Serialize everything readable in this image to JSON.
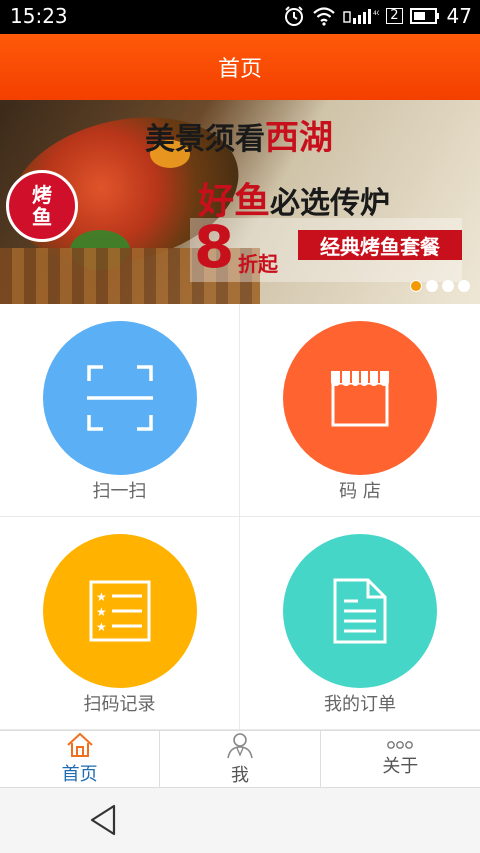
{
  "status": {
    "time": "15:23",
    "battery": "47",
    "sim": "2"
  },
  "header": {
    "title": "首页"
  },
  "banner": {
    "badge_top": "烤",
    "badge_bottom": "鱼",
    "line1_a": "美景须看",
    "line1_b": "西湖",
    "line2_a": "好鱼",
    "line2_b": "必选传炉",
    "promo_number": "8",
    "promo_unit": "折起",
    "promo_text": "经典烤鱼套餐"
  },
  "grid": [
    {
      "label": "扫一扫",
      "color": "#5aaff5",
      "icon": "scan-icon"
    },
    {
      "label": "码 店",
      "color": "#ff6430",
      "icon": "store-icon"
    },
    {
      "label": "扫码记录",
      "color": "#ffb300",
      "icon": "list-icon"
    },
    {
      "label": "我的订单",
      "color": "#45d6c8",
      "icon": "document-icon"
    }
  ],
  "tabs": [
    {
      "label": "首页",
      "icon": "home-icon",
      "active": true
    },
    {
      "label": "我",
      "icon": "person-icon",
      "active": false
    },
    {
      "label": "关于",
      "icon": "more-icon",
      "active": false
    }
  ],
  "colors": {
    "header": "#f34a04",
    "active_tab": "#1f6db0"
  }
}
